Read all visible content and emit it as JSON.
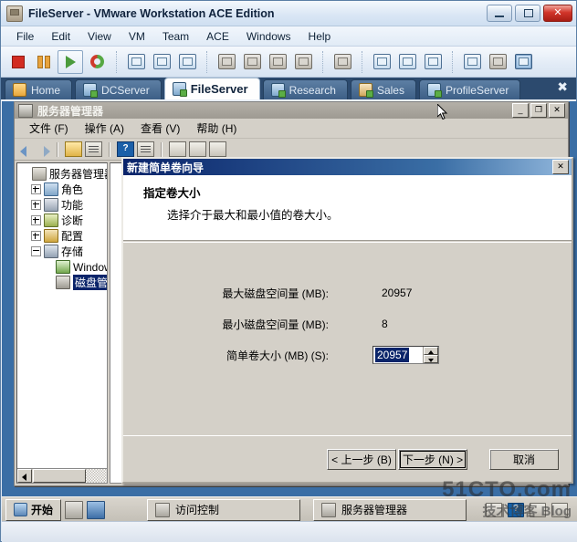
{
  "window": {
    "title": "FileServer - VMware Workstation ACE Edition",
    "icon": "vmware-window-icon",
    "controls": {
      "minimize": "minimize-button",
      "maximize": "maximize-button",
      "close": "close-button"
    }
  },
  "menubar": {
    "items": [
      "File",
      "Edit",
      "View",
      "VM",
      "Team",
      "ACE",
      "Windows",
      "Help"
    ]
  },
  "toolbar": {
    "groups": [
      [
        "stop-icon",
        "pause-icon",
        "play-icon",
        "reset-icon"
      ],
      [
        "snapshot-take-icon",
        "snapshot-revert-icon",
        "snapshot-manager-icon"
      ],
      [
        "clone-icon",
        "clone-multiple-icon",
        "vm-settings-icon",
        "removable-devices-icon"
      ],
      [
        "send-cad-icon"
      ],
      [
        "show-sidebar-icon",
        "fullscreen-icon",
        "quick-switch-icon"
      ],
      [
        "team-settings-icon",
        "summary-view-icon",
        "console-view-icon"
      ]
    ]
  },
  "tabs": {
    "items": [
      {
        "label": "Home",
        "icon": "home-icon",
        "active": false
      },
      {
        "label": "DCServer",
        "icon": "vm-icon",
        "active": false
      },
      {
        "label": "FileServer",
        "icon": "vm-icon",
        "active": true
      },
      {
        "label": "Research",
        "icon": "vm-icon",
        "active": false
      },
      {
        "label": "Sales",
        "icon": "vm-icon",
        "active": false
      },
      {
        "label": "ProfileServer",
        "icon": "vm-icon",
        "active": false
      }
    ],
    "close_label": "✖"
  },
  "mmc": {
    "title": "服务器管理器",
    "icon": "server-manager-icon",
    "controls": {
      "minimize": "_",
      "restore": "❐",
      "close": "✕"
    },
    "menu": [
      "文件 (F)",
      "操作 (A)",
      "查看 (V)",
      "帮助 (H)"
    ],
    "toolbar": [
      "back-arrow-icon",
      "forward-arrow-icon",
      "up-folder-icon",
      "show-hide-tree-icon",
      "help-icon",
      "properties-icon",
      "export-list-icon",
      "refresh-icon",
      "new-window-icon"
    ],
    "tree": [
      {
        "label": "服务器管理器",
        "icon": "server-manager-icon",
        "expander": "none",
        "depth": 0,
        "selected": false
      },
      {
        "label": "角色",
        "icon": "roles-icon",
        "expander": "plus",
        "depth": 1,
        "selected": false
      },
      {
        "label": "功能",
        "icon": "features-icon",
        "expander": "plus",
        "depth": 1,
        "selected": false
      },
      {
        "label": "诊断",
        "icon": "diagnostics-icon",
        "expander": "plus",
        "depth": 1,
        "selected": false
      },
      {
        "label": "配置",
        "icon": "configuration-icon",
        "expander": "plus",
        "depth": 1,
        "selected": false
      },
      {
        "label": "存储",
        "icon": "storage-icon",
        "expander": "minus",
        "depth": 1,
        "selected": false
      },
      {
        "label": "Windows",
        "icon": "windows-backup-icon",
        "expander": "none",
        "depth": 2,
        "selected": false
      },
      {
        "label": "磁盘管理",
        "icon": "disk-management-icon",
        "expander": "none",
        "depth": 2,
        "selected": true
      }
    ]
  },
  "wizard": {
    "title": "新建简单卷向导",
    "close_label": "✕",
    "heading": "指定卷大小",
    "subheading": "选择介于最大和最小值的卷大小。",
    "fields": [
      {
        "label": "最大磁盘空间量 (MB):",
        "value": "20957",
        "type": "static"
      },
      {
        "label": "最小磁盘空间量 (MB):",
        "value": "8",
        "type": "static"
      },
      {
        "label": "简单卷大小 (MB) (S):",
        "value": "20957",
        "type": "spinner"
      }
    ],
    "buttons": {
      "back": "< 上一步 (B)",
      "next": "下一步 (N) >",
      "cancel": "取消"
    }
  },
  "taskbar": {
    "start": "开始",
    "quick_launch": [
      "show-desktop-icon",
      "server-manager-quick-icon"
    ],
    "tasks": [
      {
        "label": "访问控制",
        "icon": "access-control-icon"
      },
      {
        "label": "服务器管理器",
        "icon": "server-manager-icon"
      }
    ],
    "tray": [
      "keyboard-icon",
      "help-tray-icon",
      "network-icon",
      "flag-icon"
    ]
  },
  "watermark": {
    "line1": "51CTO.com",
    "line2": "技术博客",
    "line3": "Blog"
  },
  "colors": {
    "accent": "#0a246a",
    "titlebar": "#dbe7f5",
    "tabstrip": "#2c4a6e",
    "dialog_face": "#d4d0c8",
    "guest_desktop": "#3a6ea5"
  }
}
